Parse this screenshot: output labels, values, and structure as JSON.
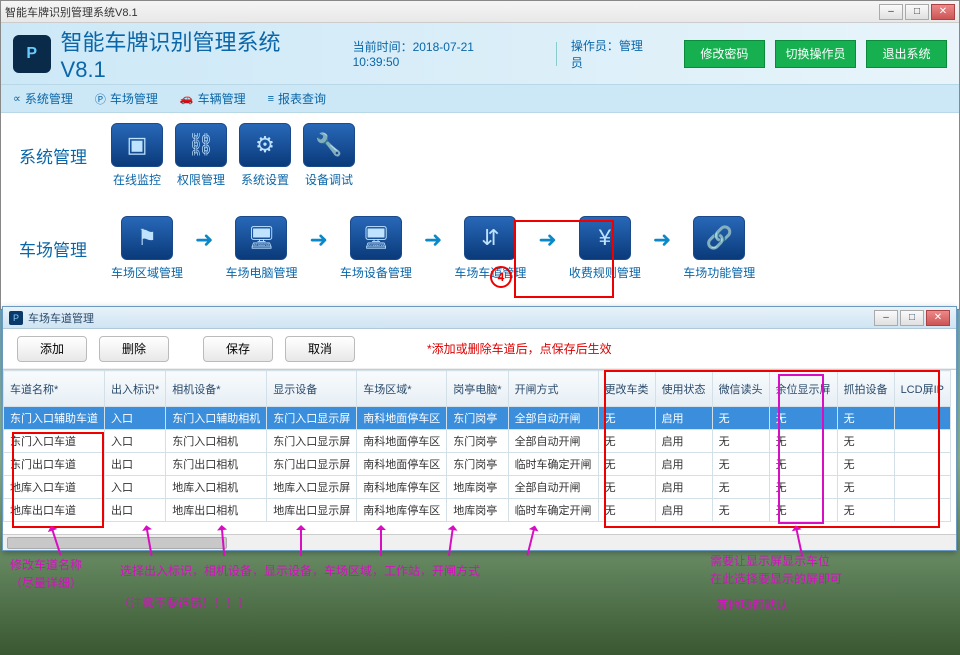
{
  "main_title": "智能车牌识别管理系统V8.1",
  "header": {
    "app_title": "智能车牌识别管理系统V8.1",
    "time_label": "当前时间：2018-07-21 10:39:50",
    "operator_label": "操作员：管理员",
    "btn_pwd": "修改密码",
    "btn_switch": "切换操作员",
    "btn_exit": "退出系统"
  },
  "menubar": [
    {
      "icon": "⚙",
      "label": "系统管理"
    },
    {
      "icon": "Ⓟ",
      "label": "车场管理"
    },
    {
      "icon": "🚗",
      "label": "车辆管理"
    },
    {
      "icon": "≡",
      "label": "报表查询"
    }
  ],
  "section1": {
    "title": "系统管理",
    "items": [
      {
        "icon": "▣",
        "label": "在线监控"
      },
      {
        "icon": "⛓",
        "label": "权限管理"
      },
      {
        "icon": "⚙",
        "label": "系统设置"
      },
      {
        "icon": "🔧",
        "label": "设备调试"
      }
    ]
  },
  "section2": {
    "title": "车场管理",
    "items": [
      {
        "icon": "⚑",
        "label": "车场区域管理"
      },
      {
        "icon": "🖥",
        "label": "车场电脑管理"
      },
      {
        "icon": "🖥",
        "label": "车场设备管理"
      },
      {
        "icon": "⇵",
        "label": "车场车道管理"
      },
      {
        "icon": "¥",
        "label": "收费规则管理"
      },
      {
        "icon": "🔗",
        "label": "车场功能管理"
      }
    ]
  },
  "step_badge": "4",
  "sub": {
    "title": "车场车道管理",
    "toolbar": {
      "add": "添加",
      "del": "删除",
      "save": "保存",
      "cancel": "取消",
      "note": "*添加或删除车道后，点保存后生效"
    },
    "columns": [
      "车道名称*",
      "出入标识*",
      "相机设备*",
      "显示设备",
      "车场区域*",
      "岗亭电脑*",
      "开闸方式",
      "更改车类",
      "使用状态",
      "微信读头",
      "余位显示屏",
      "抓拍设备",
      "LCD屏IP"
    ],
    "rows": [
      [
        "东门入口辅助车道",
        "入口",
        "东门入口辅助相机",
        "东门入口显示屏",
        "南科地面停车区",
        "东门岗亭",
        "全部自动开闸",
        "无",
        "启用",
        "无",
        "无",
        "无",
        ""
      ],
      [
        "东门入口车道",
        "入口",
        "东门入口相机",
        "东门入口显示屏",
        "南科地面停车区",
        "东门岗亭",
        "全部自动开闸",
        "无",
        "启用",
        "无",
        "无",
        "无",
        ""
      ],
      [
        "东门出口车道",
        "出口",
        "东门出口相机",
        "东门出口显示屏",
        "南科地面停车区",
        "东门岗亭",
        "临时车确定开闸",
        "无",
        "启用",
        "无",
        "无",
        "无",
        ""
      ],
      [
        "地库入口车道",
        "入口",
        "地库入口相机",
        "地库入口显示屏",
        "南科地库停车区",
        "地库岗亭",
        "全部自动开闸",
        "无",
        "启用",
        "无",
        "无",
        "无",
        ""
      ],
      [
        "地库出口车道",
        "出口",
        "地库出口相机",
        "地库出口显示屏",
        "南科地库停车区",
        "地库岗亭",
        "临时车确定开闸",
        "无",
        "启用",
        "无",
        "无",
        "无",
        ""
      ]
    ]
  },
  "annot": {
    "rename": "修改车道名称\n（尽量详细）",
    "select": "选择出入标识，相机设备，显示设备，车场区域，工作站，开闸方式",
    "careful": "（注意不要选错！！！）",
    "screen": "需要让显示屏显示车位\n在此选择要显示的屏即可",
    "default": "其他项都默认"
  }
}
